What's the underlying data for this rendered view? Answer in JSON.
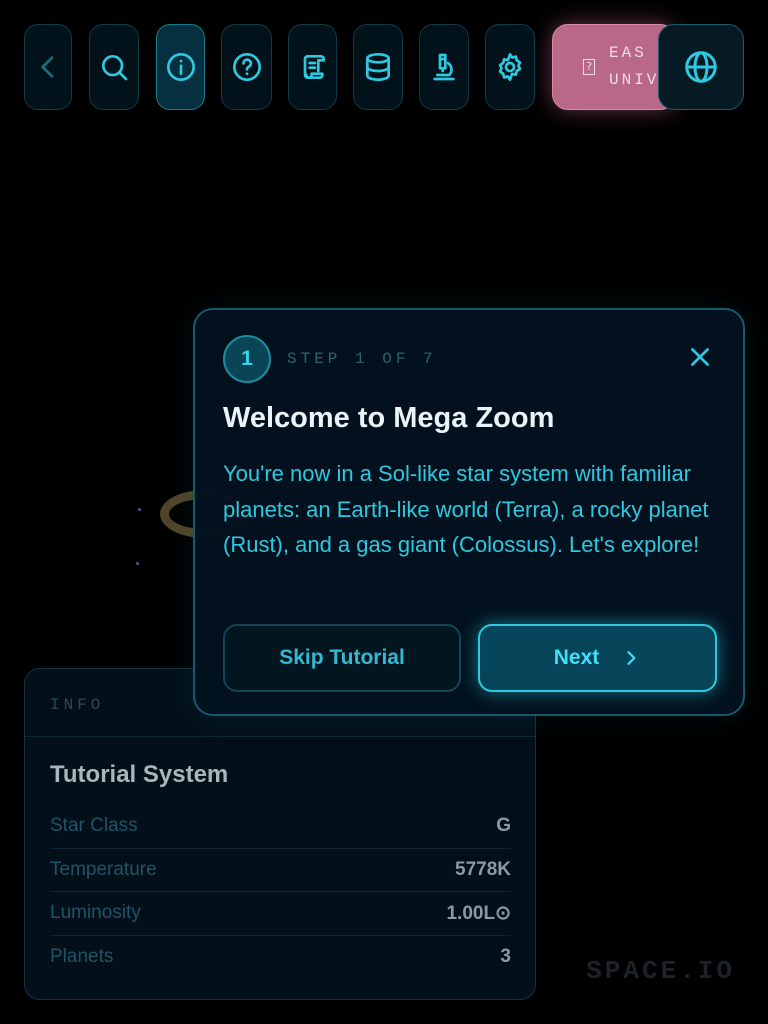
{
  "toolbar": {
    "buttons": [
      {
        "name": "back",
        "icon": "chevron-left-icon"
      },
      {
        "name": "search",
        "icon": "search-icon"
      },
      {
        "name": "info",
        "icon": "info-icon"
      },
      {
        "name": "help",
        "icon": "help-icon"
      },
      {
        "name": "scroll",
        "icon": "scroll-icon"
      },
      {
        "name": "database",
        "icon": "database-icon"
      },
      {
        "name": "microscope",
        "icon": "microscope-icon"
      },
      {
        "name": "settings",
        "icon": "gear-icon"
      }
    ],
    "difficulty": {
      "icon_glyph": "?",
      "line1": "EAS",
      "line2": "UNIV"
    },
    "globe_icon": "globe-icon"
  },
  "info_panel": {
    "header": "INFO",
    "title": "Tutorial System",
    "rows": [
      {
        "key": "Star Class",
        "value": "G"
      },
      {
        "key": "Temperature",
        "value": "5778K"
      },
      {
        "key": "Luminosity",
        "value": "1.00L⊙"
      },
      {
        "key": "Planets",
        "value": "3"
      }
    ]
  },
  "brand": "SPACE.IO",
  "tutorial": {
    "step_number": "1",
    "step_label": "STEP 1 OF 7",
    "title": "Welcome to Mega Zoom",
    "body": "You're now in a Sol-like star system with familiar planets: an Earth-like world (Terra), a rocky planet (Rust), and a gas giant (Colossus). Let's explore!",
    "skip_label": "Skip Tutorial",
    "next_label": "Next"
  },
  "colors": {
    "accent": "#2ec8e0",
    "difficulty_pink": "#b96887",
    "background": "#000000"
  }
}
